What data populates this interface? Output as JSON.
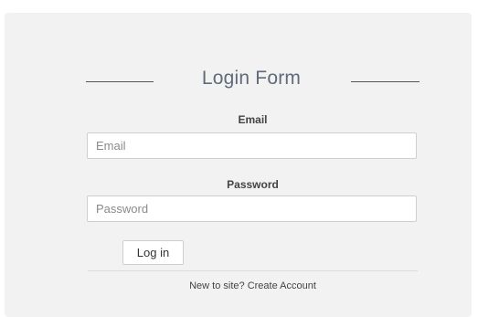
{
  "form": {
    "title": "Login Form",
    "email": {
      "label": "Email",
      "placeholder": "Email",
      "value": ""
    },
    "password": {
      "label": "Password",
      "placeholder": "Password",
      "value": ""
    },
    "submit_label": "Log in",
    "footer": {
      "prompt": "New to site?",
      "link_label": "Create Account"
    }
  }
}
